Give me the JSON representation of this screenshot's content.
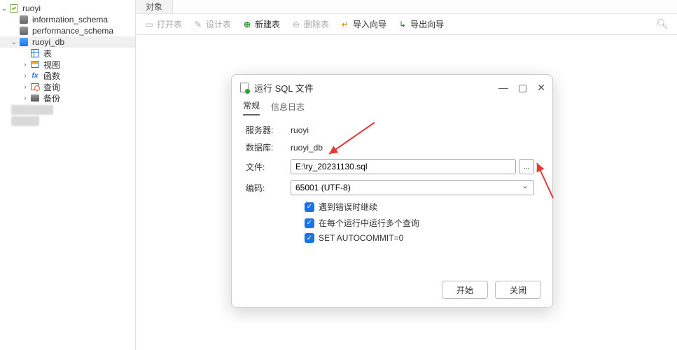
{
  "sidebar": {
    "connection": "ruoyi",
    "dbs": {
      "info_schema": "information_schema",
      "perf_schema": "performance_schema",
      "ruoyi_db": "ruoyi_db"
    },
    "children": {
      "tables": "表",
      "views": "视图",
      "functions": "函数",
      "queries": "查询",
      "backups": "备份"
    }
  },
  "main": {
    "tab_objects": "对象",
    "toolbar": {
      "open_table": "打开表",
      "design_table": "设计表",
      "new_table": "新建表",
      "delete_table": "删除表",
      "import_wizard": "导入向导",
      "export_wizard": "导出向导"
    }
  },
  "modal": {
    "title": "运行 SQL 文件",
    "tabs": {
      "general": "常规",
      "log": "信息日志"
    },
    "labels": {
      "server": "服务器:",
      "database": "数据库:",
      "file": "文件:",
      "encoding": "编码:"
    },
    "values": {
      "server": "ruoyi",
      "database": "ruoyi_db",
      "file": "E:\\ry_20231130.sql",
      "encoding": "65001 (UTF-8)",
      "browse": "..."
    },
    "checks": {
      "continue_on_error": "遇到错误时继续",
      "multi_query": "在每个运行中运行多个查询",
      "autocommit": "SET AUTOCOMMIT=0"
    },
    "buttons": {
      "start": "开始",
      "close": "关闭"
    }
  }
}
